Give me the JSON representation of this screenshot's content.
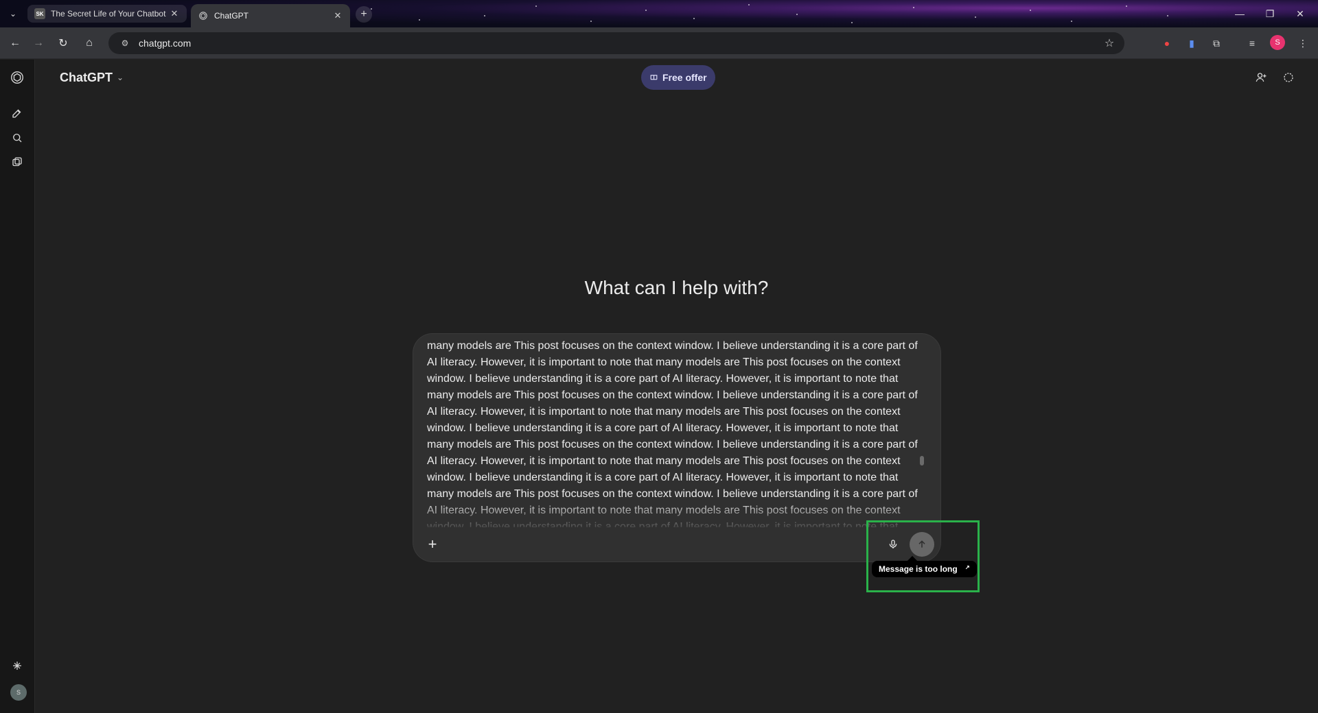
{
  "browser": {
    "tabs": [
      {
        "title": "The Secret Life of Your Chatbot",
        "favicon": "SK",
        "active": false
      },
      {
        "title": "ChatGPT",
        "favicon": "openai-logo",
        "active": true
      }
    ],
    "url": "chatgpt.com",
    "profile_initial": "S"
  },
  "app": {
    "model_name": "ChatGPT",
    "free_offer_label": "Free offer",
    "headline": "What can I help with?",
    "user_initial": "S"
  },
  "composer": {
    "lines": [
      "many models are This post focuses on the context window. I believe understanding it is a core part of",
      "AI literacy. However, it is important to note that many models are This post focuses on the context",
      "window. I believe understanding it is a core part of AI literacy. However, it is important to note that",
      "many models are This post focuses on the context window. I believe understanding it is a core part of",
      "AI literacy. However, it is important to note that many models are This post focuses on the context",
      "window. I believe understanding it is a core part of AI literacy. However, it is important to note that",
      "many models are This post focuses on the context window. I believe understanding it is a core part of",
      "AI literacy. However, it is important to note that many models are This post focuses on the context",
      "window. I believe understanding it is a core part of AI literacy. However, it is important to note that",
      "many models are This post focuses on the context window. I believe understanding it is a core part of",
      "AI literacy. However, it is important to note that many models are This post focuses on the context",
      "window. I believe understanding it is a core part of AI literacy. However, it is important to note that"
    ],
    "tooltip": "Message is too long"
  },
  "colors": {
    "highlight": "#2ab24a",
    "free_offer_bg": "#3b3b6b",
    "profile_avatar": "#e8336f"
  }
}
